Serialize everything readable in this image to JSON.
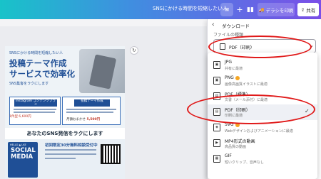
{
  "topbar": {
    "doc_title": "SNSにかける時間を短縮したい人",
    "menu_icon": "≡",
    "plus_icon": "+",
    "chart_icon": "▮▮",
    "print_label": "デラシを印刷",
    "share_label": "共有"
  },
  "flyer": {
    "subtitle": "SNSにかける時間を短縮したい人",
    "heading_line1": "投稿テーマ作成",
    "heading_line2": "サービスで効率化",
    "tagline": "SNS集客をラクにします",
    "plan_left_title": "Instagram コンテンツプラン",
    "plan_right_title": "投稿テーマ作成",
    "price_left": "1件型 6,600円",
    "price_right_prefix": "月額おまかせ",
    "price_right_value": "5,500円",
    "banner": "あなたのSNS発信をラクにします",
    "social_small": "HELLO ▲ LKE",
    "social_big_1": "SOCIAL",
    "social_big_2": "MEDIA",
    "consult": "初回限定30分無料相談受付中"
  },
  "panel": {
    "title": "ダウンロード",
    "file_type_label": "ファイルの種類",
    "selected_value": "PDF（印刷）",
    "options": [
      {
        "name": "JPG",
        "desc": "共有に最適",
        "icon": "▣"
      },
      {
        "name": "PNG",
        "desc": "画像高画質イラストに最適",
        "icon": "▣",
        "badge": true
      },
      {
        "name": "PDF（標準）",
        "desc": "文書（メール添付）に最適",
        "icon": "▤"
      },
      {
        "name": "PDF（印刷）",
        "desc": "印刷に最適",
        "icon": "▤",
        "selected": true
      },
      {
        "name": "SVG",
        "desc": "Webデザインおよびアニメーションに最適",
        "icon": "◈",
        "badge": true
      },
      {
        "name": "MP4形式の動画",
        "desc": "高品質の動画",
        "icon": "▶"
      },
      {
        "name": "GIF",
        "desc": "短いクリップ、音声なし",
        "icon": "▦"
      }
    ]
  },
  "colors": {
    "accent": "#3f8fe0",
    "annotation": "#e01919",
    "flyer_blue": "#1f4f96"
  }
}
